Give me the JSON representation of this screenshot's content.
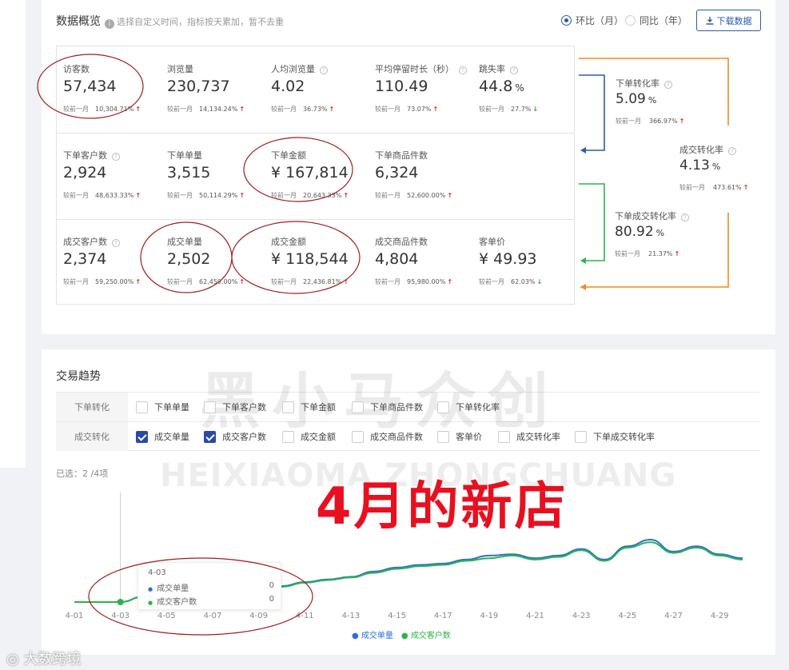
{
  "overview": {
    "title": "数据概览",
    "hint": "选择自定义时间，指标按天累加，暂不去重",
    "radio_mom": "环比（月）",
    "radio_yoy": "同比（年）",
    "download": "下载数据",
    "compare_label": "较前一月",
    "rows": [
      [
        {
          "label": "访客数",
          "help": false,
          "value": "57,434",
          "unit": "",
          "pct": "10,304.71%",
          "trend": "up"
        },
        {
          "label": "浏览量",
          "help": false,
          "value": "230,737",
          "unit": "",
          "pct": "14,134.24%",
          "trend": "up"
        },
        {
          "label": "人均浏览量",
          "help": true,
          "value": "4.02",
          "unit": "",
          "pct": "36.73%",
          "trend": "up"
        },
        {
          "label": "平均停留时长（秒）",
          "help": true,
          "value": "110.49",
          "unit": "",
          "pct": "73.07%",
          "trend": "up"
        },
        {
          "label": "跳失率",
          "help": true,
          "value": "44.8",
          "unit": "%",
          "pct": "27.7%",
          "trend": "down"
        }
      ],
      [
        {
          "label": "下单客户数",
          "help": true,
          "value": "2,924",
          "unit": "",
          "pct": "48,633.33%",
          "trend": "up"
        },
        {
          "label": "下单单量",
          "help": false,
          "value": "3,515",
          "unit": "",
          "pct": "50,114.29%",
          "trend": "up"
        },
        {
          "label": "下单金额",
          "help": false,
          "value": "¥ 167,814",
          "unit": "",
          "pct": "20,643.33%",
          "trend": "up"
        },
        {
          "label": "下单商品件数",
          "help": false,
          "value": "6,324",
          "unit": "",
          "pct": "52,600.00%",
          "trend": "up"
        }
      ],
      [
        {
          "label": "成交客户数",
          "help": true,
          "value": "2,374",
          "unit": "",
          "pct": "59,250.00%",
          "trend": "up"
        },
        {
          "label": "成交单量",
          "help": false,
          "value": "2,502",
          "unit": "",
          "pct": "62,450.00%",
          "trend": "up"
        },
        {
          "label": "成交金额",
          "help": false,
          "value": "¥ 118,544",
          "unit": "",
          "pct": "22,436.81%",
          "trend": "up"
        },
        {
          "label": "成交商品件数",
          "help": false,
          "value": "4,804",
          "unit": "",
          "pct": "95,980.00%",
          "trend": "up"
        },
        {
          "label": "客单价",
          "help": false,
          "value": "¥ 49.93",
          "unit": "",
          "pct": "62.03%",
          "trend": "down"
        }
      ]
    ],
    "conversions": [
      {
        "label": "下单转化率",
        "value": "5.09",
        "unit": "%",
        "pct": "366.97%"
      },
      {
        "label": "成交转化率",
        "value": "4.13",
        "unit": "%",
        "pct": "473.61%"
      },
      {
        "label": "下单成交转化率",
        "value": "80.92",
        "unit": "%",
        "pct": "21.37%"
      }
    ],
    "colors": {
      "accent": "#2a5caa",
      "orange": "#f08c1e",
      "blue_arrow": "#2a5caa",
      "green_arrow": "#2cb34a",
      "up": "#e02020",
      "down": "#2ca02c"
    }
  },
  "trend": {
    "title": "交易趋势",
    "filter_rows": [
      {
        "head": "下单转化",
        "items": [
          {
            "label": "下单单量",
            "checked": false
          },
          {
            "label": "下单客户数",
            "checked": false
          },
          {
            "label": "下单金额",
            "checked": false
          },
          {
            "label": "下单商品件数",
            "checked": false
          },
          {
            "label": "下单转化率",
            "checked": false
          }
        ]
      },
      {
        "head": "成交转化",
        "items": [
          {
            "label": "成交单量",
            "checked": true
          },
          {
            "label": "成交客户数",
            "checked": true
          },
          {
            "label": "成交金额",
            "checked": false
          },
          {
            "label": "成交商品件数",
            "checked": false
          },
          {
            "label": "客单价",
            "checked": false
          },
          {
            "label": "成交转化率",
            "checked": false
          },
          {
            "label": "下单成交转化率",
            "checked": false
          }
        ]
      }
    ],
    "selected": "已选：2 /4项",
    "tooltip": {
      "date": "4-03",
      "rows": [
        {
          "name": "成交单量",
          "value": "0"
        },
        {
          "name": "成交客户数",
          "value": "0"
        }
      ]
    },
    "legend": [
      "成交单量",
      "成交客户数"
    ]
  },
  "chart_data": {
    "type": "line",
    "x": [
      "4-01",
      "4-02",
      "4-03",
      "4-04",
      "4-05",
      "4-06",
      "4-07",
      "4-08",
      "4-09",
      "4-10",
      "4-11",
      "4-12",
      "4-13",
      "4-14",
      "4-15",
      "4-16",
      "4-17",
      "4-18",
      "4-19",
      "4-20",
      "4-21",
      "4-22",
      "4-23",
      "4-24",
      "4-25",
      "4-26",
      "4-27",
      "4-28",
      "4-29",
      "4-30"
    ],
    "xticks": [
      "4-01",
      "4-03",
      "4-05",
      "4-07",
      "4-09",
      "4-11",
      "4-13",
      "4-15",
      "4-17",
      "4-19",
      "4-21",
      "4-23",
      "4-25",
      "4-27",
      "4-29"
    ],
    "series": [
      {
        "name": "成交单量",
        "color": "#2f6ed8",
        "values": [
          0,
          0,
          0,
          8,
          14,
          22,
          30,
          24,
          18,
          24,
          30,
          34,
          38,
          46,
          52,
          56,
          58,
          64,
          70,
          72,
          66,
          70,
          80,
          64,
          84,
          94,
          76,
          84,
          72,
          66
        ]
      },
      {
        "name": "成交客户数",
        "color": "#2cb34a",
        "values": [
          0,
          0,
          0,
          8,
          14,
          22,
          30,
          24,
          18,
          23,
          29,
          33,
          37,
          44,
          50,
          54,
          56,
          62,
          66,
          70,
          64,
          68,
          78,
          62,
          82,
          90,
          74,
          82,
          70,
          64
        ]
      }
    ],
    "ylim": [
      0,
      110
    ],
    "hover_x": "4-03"
  },
  "overlays": {
    "watermark_cn": "黑小马众创",
    "watermark_en": "HEIXIAOMA ZHONGCHUANG",
    "banner": "4月的新店",
    "corner_logo": "大数跨境"
  }
}
